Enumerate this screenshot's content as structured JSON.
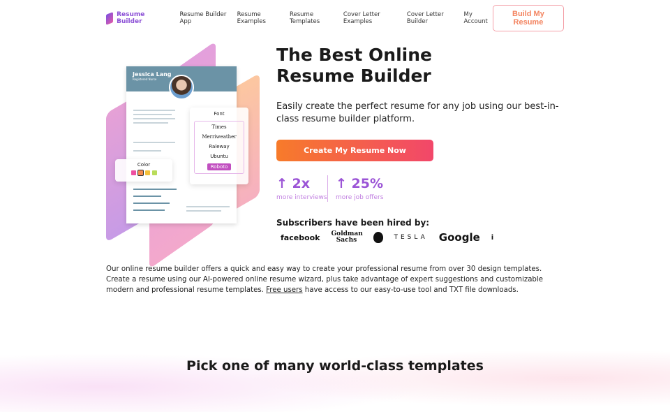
{
  "nav": {
    "logo": "Resume Builder",
    "links": [
      "Resume Builder App",
      "Resume Examples",
      "Resume Templates",
      "Cover Letter Examples",
      "Cover Letter Builder",
      "My Account"
    ],
    "cta": "Build My Resume"
  },
  "hero": {
    "title_line1": "The Best Online",
    "title_line2": "Resume Builder",
    "subtitle": "Easily create the perfect resume for any job using our best-in-class resume builder platform.",
    "cta": "Create My Resume Now",
    "stats": [
      {
        "value": "2x",
        "label": "more interviews"
      },
      {
        "value": "25%",
        "label": "more job offers"
      }
    ],
    "hired_title": "Subscribers have been hired by:",
    "brands": [
      "facebook",
      "Goldman Sachs",
      "apple",
      "TESLA",
      "Google",
      "i"
    ]
  },
  "illustration": {
    "name": "Jessica Lang",
    "role": "Registered Nurse",
    "font_title": "Font",
    "fonts": [
      "Times",
      "Merriweather",
      "Raleway",
      "Ubuntu",
      "Roboto"
    ],
    "color_title": "Color",
    "swatches": [
      "#ee4fa0",
      "#f38a4c",
      "#f4c03a",
      "#b9dc5a"
    ]
  },
  "body": {
    "text_before": "Our online resume builder offers a quick and easy way to create your professional resume from over 30 design templates. Create a resume using our AI-powered online resume wizard, plus take advantage of expert suggestions and customizable modern and professional resume templates. ",
    "link": "Free users",
    "text_after": " have access to our easy-to-use tool and TXT file downloads."
  },
  "section_title": "Pick one of many world-class templates"
}
